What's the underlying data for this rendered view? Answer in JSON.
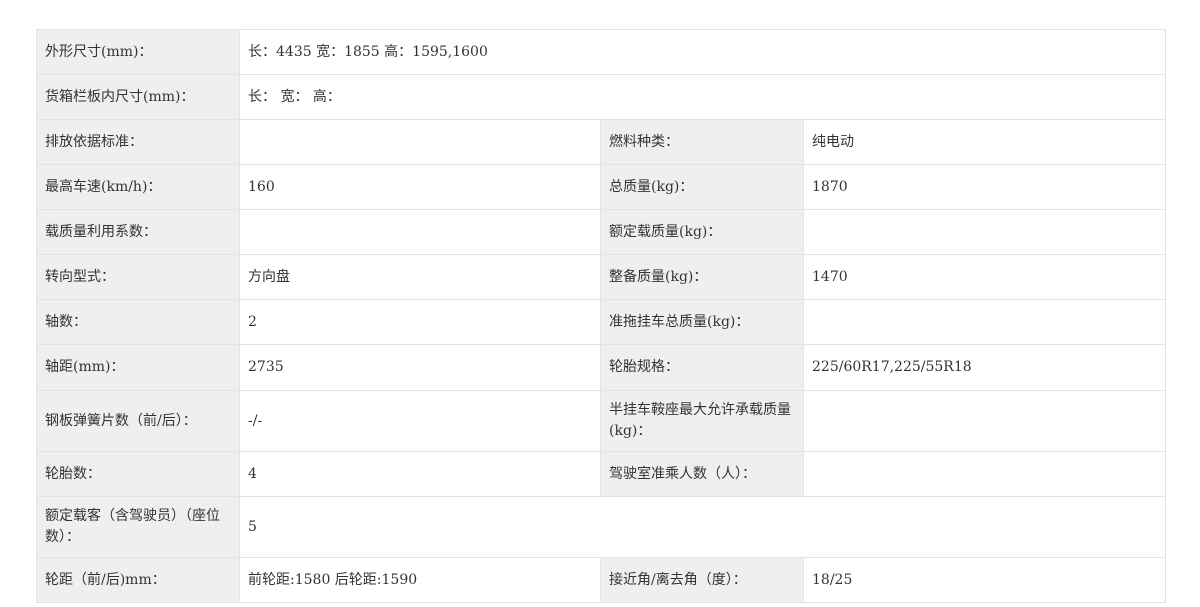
{
  "rows": [
    {
      "label": "外形尺寸(mm)：",
      "value": "长：4435 宽：1855 高：1595,1600"
    },
    {
      "label": "货箱栏板内尺寸(mm)：",
      "value": "长：  宽：  高："
    },
    {
      "label": "排放依据标准：",
      "value": "",
      "label2": "燃料种类：",
      "value2": "纯电动"
    },
    {
      "label": "最高车速(km/h)：",
      "value": "160",
      "label2": "总质量(kg)：",
      "value2": "1870"
    },
    {
      "label": "载质量利用系数：",
      "value": "",
      "label2": "额定载质量(kg)：",
      "value2": ""
    },
    {
      "label": "转向型式：",
      "value": "方向盘",
      "label2": "整备质量(kg)：",
      "value2": "1470"
    },
    {
      "label": "轴数：",
      "value": "2",
      "label2": "准拖挂车总质量(kg)：",
      "value2": ""
    },
    {
      "label": "轴距(mm)：",
      "value": "2735",
      "label2": "轮胎规格：",
      "value2": "225/60R17,225/55R18"
    },
    {
      "label": "钢板弹簧片数（前/后）：",
      "value": "-/-",
      "label2": "半挂车鞍座最大允许承载质量(kg)：",
      "value2": ""
    },
    {
      "label": "轮胎数：",
      "value": "4",
      "label2": "驾驶室准乘人数（人）：",
      "value2": ""
    },
    {
      "label": "额定载客（含驾驶员）（座位数）：",
      "value": "5"
    },
    {
      "label": "轮距（前/后)mm：",
      "value": "前轮距:1580 后轮距:1590",
      "label2": "接近角/离去角（度）：",
      "value2": "18/25"
    }
  ]
}
